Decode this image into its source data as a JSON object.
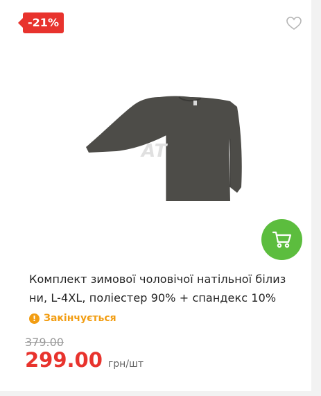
{
  "badge": {
    "discount": "-21%"
  },
  "product": {
    "watermark": "AT",
    "title_line1": "Комплект зимової чоловічої натільної білиз",
    "title_line2": "ни, L-4XL, поліестер 90% + спандекс 10%",
    "stock_status": "Закінчується",
    "stock_icon": "!",
    "old_price": "379.00",
    "price": "299.00",
    "unit": "грн/шт"
  },
  "icons": {
    "favorite": "heart-icon",
    "cart": "cart-icon",
    "stock": "exclamation-icon"
  },
  "colors": {
    "accent_red": "#e8332d",
    "cart_green": "#5cbd3e",
    "warning_orange": "#f29d12"
  }
}
